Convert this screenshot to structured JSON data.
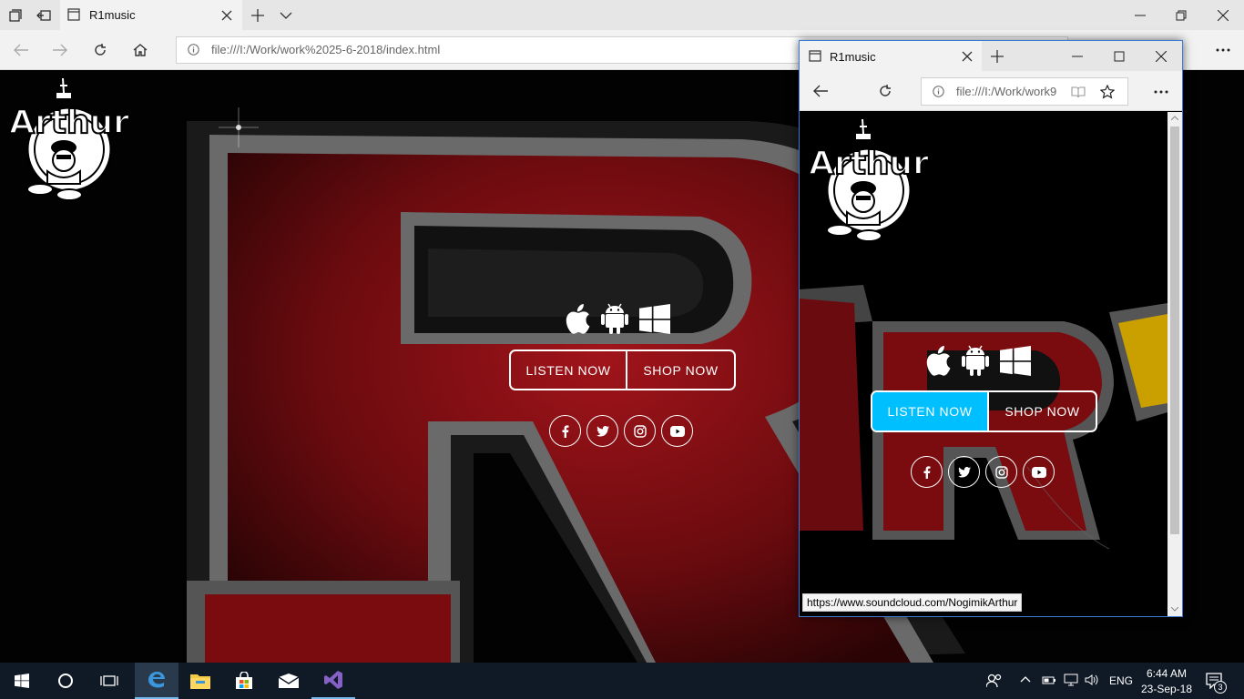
{
  "main_browser": {
    "tab_title": "R1music",
    "address": "file:///I:/Work/work%2025-6-2018/index.html",
    "page": {
      "listen_label": "LISTEN NOW",
      "shop_label": "SHOP NOW",
      "platform_icons": [
        "apple-icon",
        "android-icon",
        "windows-icon"
      ],
      "social_icons": [
        "facebook-icon",
        "twitter-icon",
        "instagram-icon",
        "youtube-icon"
      ]
    }
  },
  "popup": {
    "tab_title": "R1music",
    "address": "file:///I:/Work/work9",
    "page": {
      "listen_label": "LISTEN NOW",
      "shop_label": "SHOP NOW"
    },
    "status_url": "https://www.soundcloud.com/NogimikArthur"
  },
  "taskbar": {
    "language": "ENG",
    "time": "6:44 AM",
    "date": "23-Sep-18",
    "notification_count": "3"
  },
  "colors": {
    "listen_hover_bg": "#00bfff",
    "r_logo_red": "#7a0c10",
    "r_logo_gold": "#c9a000"
  }
}
